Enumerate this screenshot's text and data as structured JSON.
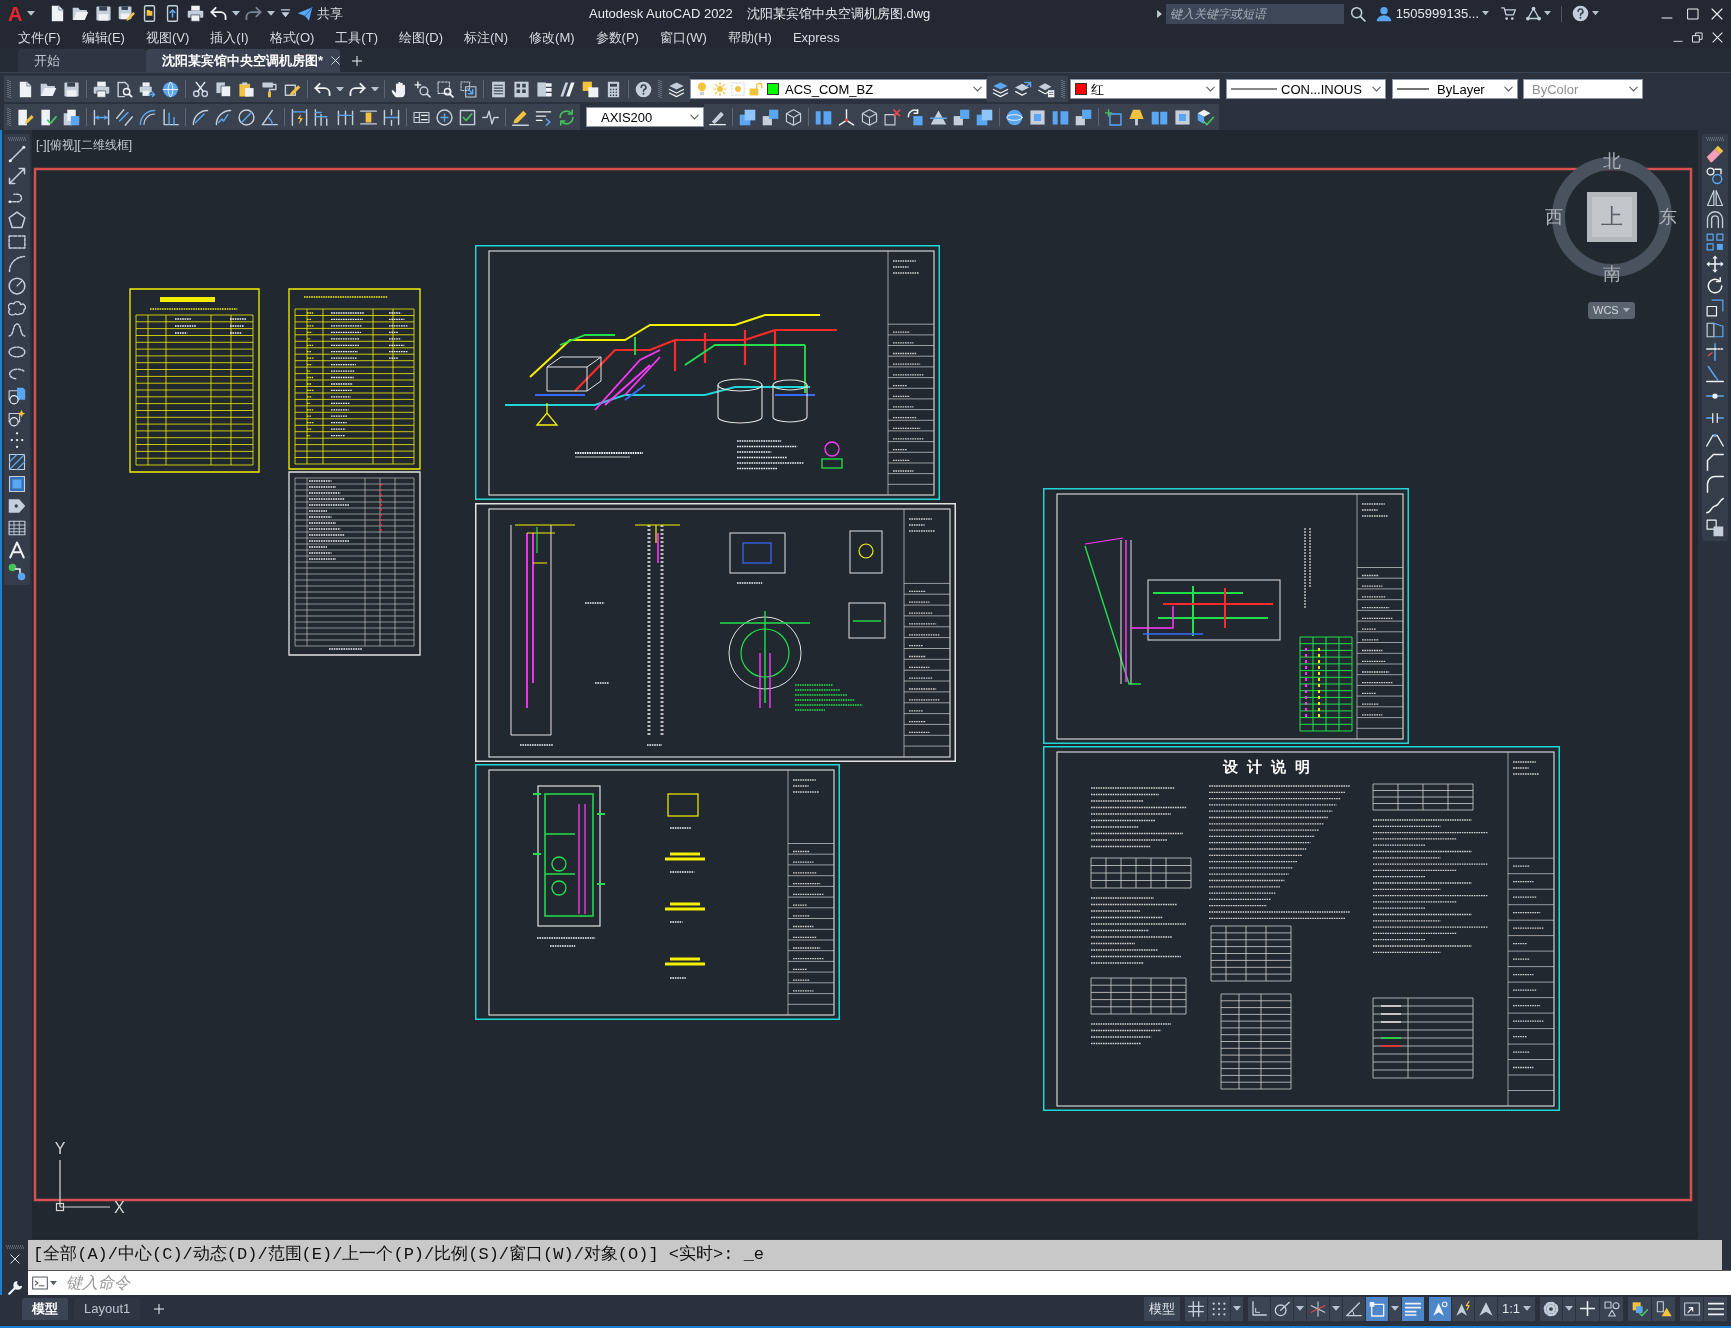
{
  "title_bar": {
    "app_logo": "A",
    "share_label": "共享",
    "app_title": "Autodesk AutoCAD 2022",
    "file_name": "沈阳某宾馆中央空调机房图.dwg",
    "search": {
      "placeholder": "键入关键字或短语"
    },
    "user_name": "1505999135..."
  },
  "menu_bar": {
    "items": [
      "文件(F)",
      "编辑(E)",
      "视图(V)",
      "插入(I)",
      "格式(O)",
      "工具(T)",
      "绘图(D)",
      "标注(N)",
      "修改(M)",
      "参数(P)",
      "窗口(W)",
      "帮助(H)",
      "Express"
    ]
  },
  "file_tabs": [
    {
      "label": "开始",
      "selected": false
    },
    {
      "label": "沈阳某宾馆中央空调机房图*",
      "selected": true
    }
  ],
  "toolbars": {
    "layer": {
      "name": "ACS_COM_BZ",
      "color": "#00ff00"
    },
    "color": {
      "label": "红",
      "color": "#ff0000"
    },
    "linetype": "CON...INOUS",
    "lineweight": "ByLayer",
    "plot_style": {
      "value": "ByColor",
      "disabled": true
    },
    "dimension_style": "AXIS200"
  },
  "model_space": {
    "viewport_label": "[-][俯视][二维线框]",
    "viewcube": {
      "face": "上",
      "north": "北",
      "south": "南",
      "west": "西",
      "east": "东",
      "coordinate_system": "WCS"
    },
    "ucs_icon": {
      "y_label": "Y",
      "x_label": "X"
    },
    "design_notes_title": "设计说明"
  },
  "command_line": {
    "history": "[全部(A)/中心(C)/动态(D)/范围(E)/上一个(P)/比例(S)/窗口(W)/对象(O)] <实时>: _e",
    "placeholder": "键入命令"
  },
  "status_bar": {
    "layout_tabs": [
      {
        "label": "模型",
        "selected": true
      },
      {
        "label": "Layout1",
        "selected": false
      }
    ],
    "space_button": "模型",
    "toggles": [
      {
        "on": false
      },
      {
        "on": false
      },
      {
        "on": false
      },
      {
        "on": false
      },
      {
        "on": false
      },
      {
        "on": false
      },
      {
        "on": true
      },
      {
        "on": true
      },
      {
        "on": true
      },
      {
        "on": false
      }
    ],
    "annotation_scale": "1:1"
  }
}
